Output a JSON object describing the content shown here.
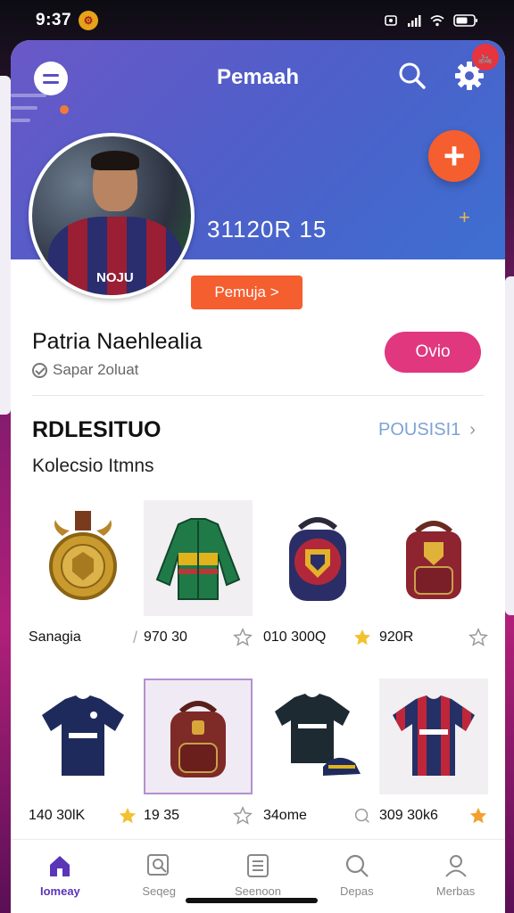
{
  "status_bar": {
    "time": "9:37"
  },
  "header": {
    "title": "Pemaah",
    "stat_value": "31120R 15",
    "notification_icon": "bike-icon",
    "colors": {
      "gradient_start": "#6a58c8",
      "gradient_end": "#3d6fd1",
      "fab": "#f55e2f"
    }
  },
  "profile": {
    "badge_button": "Pemuja >",
    "name": "Patria Naehlealia",
    "subtitle": "Sapar 2oluat",
    "action_button": "Ovio",
    "avatar_jersey_text": "NOJU"
  },
  "section": {
    "title": "RDLESITUO",
    "link": "POUSISI1",
    "subtitle": "Kolecsio Itmns"
  },
  "items": [
    {
      "label": "Sanagia",
      "icon": "medal",
      "mark": "slash"
    },
    {
      "label": "970 30",
      "icon": "green-jacket",
      "mark": "star-outline"
    },
    {
      "label": "010 300Q",
      "icon": "crest-backpack",
      "mark": "star-filled"
    },
    {
      "label": "920R",
      "icon": "red-backpack",
      "mark": "star-outline"
    },
    {
      "label": "140 30lK",
      "icon": "navy-jersey",
      "mark": "star-filled"
    },
    {
      "label": "19 35",
      "icon": "maroon-backpack",
      "mark": "star-outline"
    },
    {
      "label": "34ome",
      "icon": "dark-jersey-cap",
      "mark": "search-outline"
    },
    {
      "label": "309 30k6",
      "icon": "striped-jersey",
      "mark": "star-filled"
    }
  ],
  "bottom_nav": [
    {
      "label": "Iomeay",
      "icon": "home-icon",
      "active": true
    },
    {
      "label": "Seqeg",
      "icon": "search-doc-icon",
      "active": false
    },
    {
      "label": "Seenoon",
      "icon": "list-icon",
      "active": false
    },
    {
      "label": "Depas",
      "icon": "search-icon",
      "active": false
    },
    {
      "label": "Merbas",
      "icon": "user-icon",
      "active": false
    }
  ]
}
